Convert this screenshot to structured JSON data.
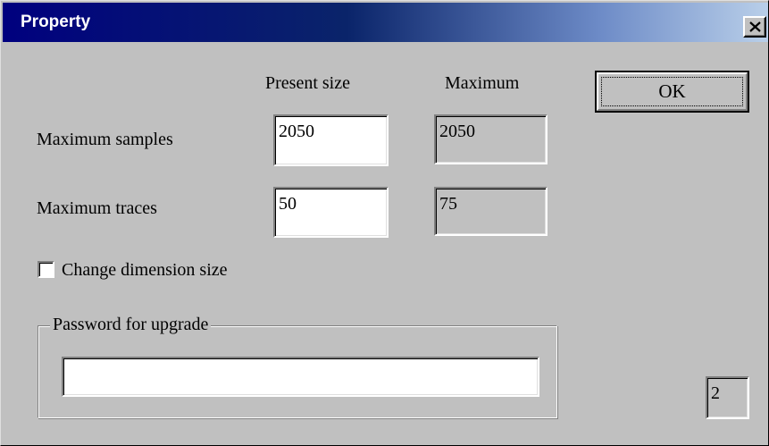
{
  "window": {
    "title": "Property",
    "close_glyph": "close-x-icon"
  },
  "headers": {
    "present_size": "Present size",
    "maximum": "Maximum"
  },
  "rows": [
    {
      "label": "Maximum samples",
      "present_value": "2050",
      "maximum_value": "2050"
    },
    {
      "label": "Maximum traces",
      "present_value": "50",
      "maximum_value": "75"
    }
  ],
  "ok_button": {
    "label": "OK"
  },
  "change_dimension": {
    "label": "Change dimension size",
    "checked": false
  },
  "password_group": {
    "label": "Password for upgrade",
    "value": ""
  },
  "status_field": {
    "value": "2"
  },
  "colors": {
    "titlebar_start": "#00007f",
    "titlebar_end": "#b9cfe9",
    "face": "#c0c0c0"
  }
}
